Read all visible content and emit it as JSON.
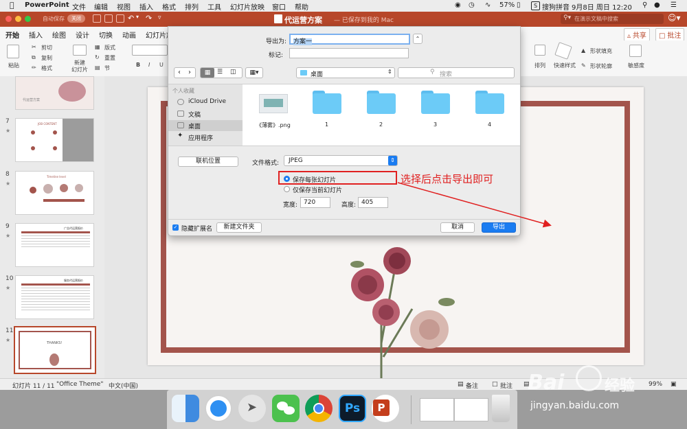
{
  "menubar": {
    "app": "PowerPoint",
    "items": [
      "文件",
      "编辑",
      "视图",
      "插入",
      "格式",
      "排列",
      "工具",
      "幻灯片放映",
      "窗口",
      "帮助"
    ],
    "battery": "57%",
    "ime": "搜狗拼音",
    "datetime": "9月8日 周日 12:20"
  },
  "titlebar": {
    "autosave_label": "自动保存",
    "autosave_state": "关闭",
    "doc_title": "代运营方案",
    "doc_status": "— 已保存到我的 Mac",
    "search_placeholder": "在演示文稿中搜索"
  },
  "ribbon": {
    "tabs": [
      "开始",
      "插入",
      "绘图",
      "设计",
      "切换",
      "动画",
      "幻灯片放"
    ],
    "share": "共享",
    "comments": "批注",
    "paste": "粘贴",
    "cut": "剪切",
    "copy": "复制",
    "format": "格式",
    "new_slide_1": "新建",
    "new_slide_2": "幻灯片",
    "layout": "版式",
    "reset": "重置",
    "section": "节",
    "arrange": "排列",
    "quick_styles": "快速样式",
    "shape_fill": "形状填充",
    "shape_outline": "形状轮廓",
    "sensitivity": "敏感度"
  },
  "thumbnails": [
    {
      "num": "7",
      "title": "JOB CONTENT"
    },
    {
      "num": "8",
      "title": "Timeline level"
    },
    {
      "num": "9",
      "title": "广告代运营报价"
    },
    {
      "num": "10",
      "title": "服务代运营报价"
    },
    {
      "num": "11",
      "title": "THANKS!"
    }
  ],
  "thumb_text": {
    "t6": "代运营方案"
  },
  "dialog": {
    "export_as_label": "导出为:",
    "export_as_value": "方案一",
    "tags_label": "标记:",
    "location": "桌面",
    "search_placeholder": "搜索",
    "sidebar_header": "个人收藏",
    "sidebar": [
      "iCloud Drive",
      "文稿",
      "桌面",
      "应用程序"
    ],
    "files": [
      {
        "name": "《薄雾》.png",
        "type": "image"
      },
      {
        "name": "1",
        "type": "folder"
      },
      {
        "name": "2",
        "type": "folder"
      },
      {
        "name": "3",
        "type": "folder"
      },
      {
        "name": "4",
        "type": "folder"
      }
    ],
    "online_locations": "联机位置",
    "format_label": "文件格式:",
    "format_value": "JPEG",
    "option_all": "保存每张幻灯片",
    "option_current": "仅保存当前幻灯片",
    "width_label": "宽度:",
    "width_value": "720",
    "height_label": "高度:",
    "height_value": "405",
    "hide_ext": "隐藏扩展名",
    "new_folder": "新建文件夹",
    "cancel": "取消",
    "export": "导出"
  },
  "annotation": {
    "text": "选择后点击导出即可",
    "color": "#e02020"
  },
  "status": {
    "slide": "幻灯片 11 / 11",
    "theme": "\"Office Theme\"",
    "lang": "中文(中国)",
    "notes": "备注",
    "comments": "批注",
    "zoom": "99%"
  },
  "watermark": {
    "brand": "Bai",
    "brand2": "经验",
    "url": "jingyan.baidu.com"
  },
  "colors": {
    "accent": "#b7472a",
    "frame": "#a3544c",
    "export_blue": "#1a7cf1"
  }
}
